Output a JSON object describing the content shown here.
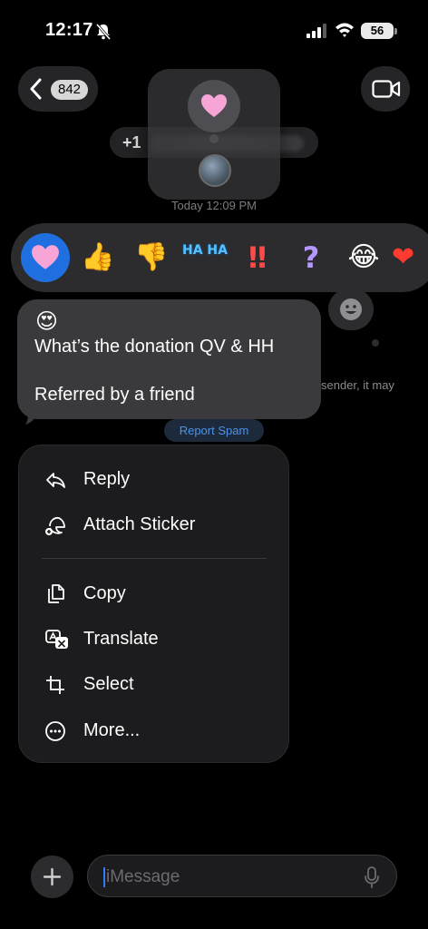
{
  "status_bar": {
    "time": "12:17",
    "battery": "56"
  },
  "header": {
    "back_count": "842",
    "contact_name": "+1"
  },
  "timestamp": "Today 12:09 PM",
  "reactions": [
    {
      "name": "heart",
      "glyph": "🩷",
      "active": true
    },
    {
      "name": "thumbs-up",
      "glyph": "👍"
    },
    {
      "name": "thumbs-down",
      "glyph": "👎"
    },
    {
      "name": "haha",
      "glyph": "HA HA"
    },
    {
      "name": "exclamation",
      "glyph": "‼"
    },
    {
      "name": "question",
      "glyph": "?"
    },
    {
      "name": "laughing",
      "glyph": "😂"
    },
    {
      "name": "red-heart",
      "glyph": "❤"
    }
  ],
  "background_note": "sender, it may",
  "message": {
    "emoji": "😍",
    "line1": "What’s the donation QV & HH",
    "line2": "Referred by a friend"
  },
  "report_spam": "Report Spam",
  "context_menu": {
    "items": [
      {
        "label": "Reply",
        "icon": "reply-icon"
      },
      {
        "label": "Attach Sticker",
        "icon": "sticker-icon"
      },
      {
        "label": "Copy",
        "icon": "copy-icon"
      },
      {
        "label": "Translate",
        "icon": "translate-icon"
      },
      {
        "label": "Select",
        "icon": "crop-select-icon"
      },
      {
        "label": "More...",
        "icon": "ellipsis-circle-icon"
      }
    ]
  },
  "composer": {
    "placeholder": "iMessage"
  },
  "colors": {
    "accent": "#1f6fe0",
    "background": "#000000",
    "bubble": "#3a3a3c",
    "menu": "#1c1c1e"
  }
}
